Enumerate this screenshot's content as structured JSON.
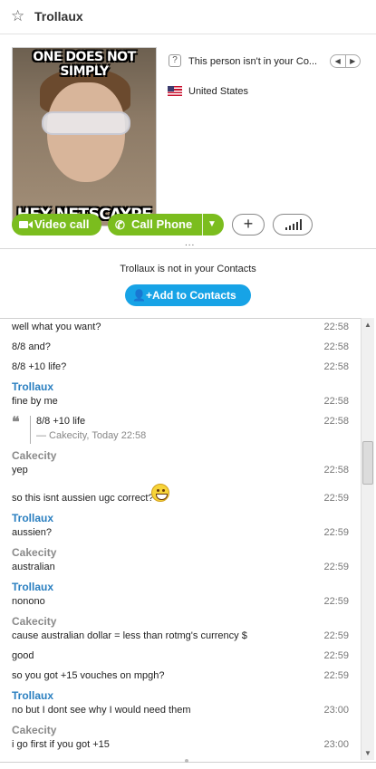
{
  "header": {
    "contact_name": "Trollaux",
    "star_icon": "star-outline-icon"
  },
  "profile": {
    "meme_top": "ONE DOES NOT SIMPLY",
    "meme_bottom": "HEX NETSCAYPE",
    "contact_status": "This person isn't in your Co...",
    "country": "United States"
  },
  "actions": {
    "video_call": "Video call",
    "call_phone": "Call Phone",
    "add_icon": "+",
    "more": "..."
  },
  "notice": {
    "text": "Trollaux is not in your Contacts",
    "add_button": "Add to Contacts"
  },
  "messages": [
    {
      "text": "well what you want?",
      "time": "22:58"
    },
    {
      "text": "8/8 and?",
      "time": "22:58"
    },
    {
      "text": "8/8 +10 life?",
      "time": "22:58"
    },
    {
      "sender": "Trollaux",
      "text": "fine by me",
      "time": "22:58"
    },
    {
      "quote_text": "8/8 +10 life",
      "quote_meta": "— Cakecity, Today 22:58",
      "time": "22:58"
    },
    {
      "sender": "Cakecity",
      "text": "yep",
      "time": "22:58"
    },
    {
      "text": "so this isnt aussien ugc correct?",
      "time": "22:59"
    },
    {
      "sender": "Trollaux",
      "text": "aussien?",
      "time": "22:59"
    },
    {
      "sender": "Cakecity",
      "text": "australian",
      "time": "22:59"
    },
    {
      "sender": "Trollaux",
      "text": "nonono",
      "time": "22:59"
    },
    {
      "sender": "Cakecity",
      "text": "cause australian dollar = less than rotmg's currency $",
      "time": "22:59"
    },
    {
      "text": "good",
      "time": "22:59"
    },
    {
      "text": "so you got +15 vouches on mpgh?",
      "time": "22:59"
    },
    {
      "sender": "Trollaux",
      "text": "no but I dont see why I would need them",
      "time": "23:00"
    },
    {
      "sender": "Cakecity",
      "text": "i go first if you got +15",
      "time": "23:00"
    }
  ],
  "colors": {
    "green": "#7bbd1e",
    "blue": "#17a3e6",
    "contact_name_color": "#2a7fc0",
    "self_name_color": "#8a8a8a"
  }
}
